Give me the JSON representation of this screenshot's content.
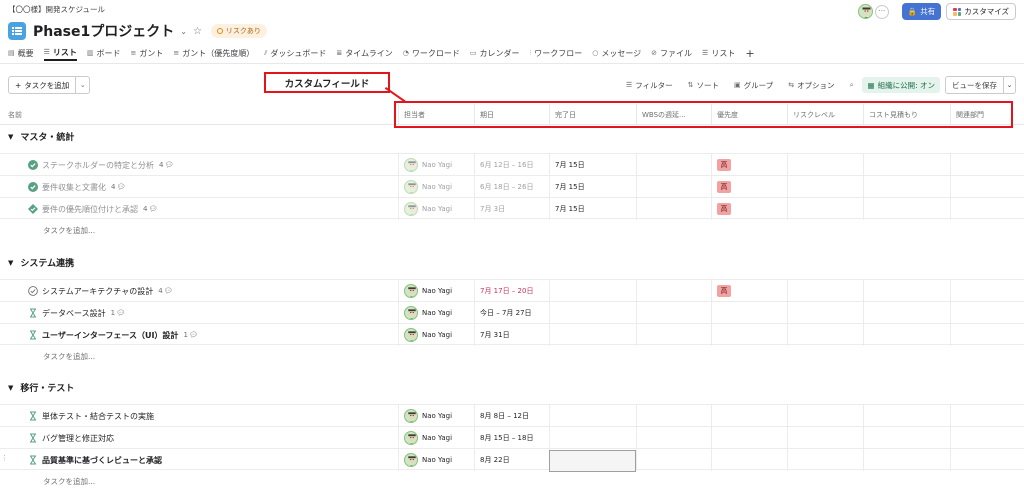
{
  "breadcrumb": "【〇〇様】開発スケジュール",
  "project": {
    "title": "Phase1プロジェクト",
    "risk_label": "リスクあり"
  },
  "top_right": {
    "share_label": "共有",
    "customize_label": "カスタマイズ"
  },
  "tabs": [
    {
      "label": "概要",
      "icon": "overview-icon"
    },
    {
      "label": "リスト",
      "icon": "list-icon",
      "active": true
    },
    {
      "label": "ボード",
      "icon": "board-icon"
    },
    {
      "label": "ガント",
      "icon": "gantt-icon"
    },
    {
      "label": "ガント（優先度順）",
      "icon": "gantt-icon"
    },
    {
      "label": "ダッシュボード",
      "icon": "dashboard-icon"
    },
    {
      "label": "タイムライン",
      "icon": "timeline-icon"
    },
    {
      "label": "ワークロード",
      "icon": "workload-icon"
    },
    {
      "label": "カレンダー",
      "icon": "calendar-icon"
    },
    {
      "label": "ワークフロー",
      "icon": "workflow-icon"
    },
    {
      "label": "メッセージ",
      "icon": "message-icon"
    },
    {
      "label": "ファイル",
      "icon": "file-icon"
    },
    {
      "label": "リスト",
      "icon": "list-icon"
    }
  ],
  "toolbar": {
    "add_task": "タスクを追加",
    "filter": "フィルター",
    "sort": "ソート",
    "group": "グループ",
    "options": "オプション",
    "org_public": "組織に公開: オン",
    "save_view": "ビューを保存"
  },
  "callout": "カスタムフィールド",
  "columns": [
    "名前",
    "担当者",
    "期日",
    "完了日",
    "WBSの週延...",
    "優先度",
    "リスクレベル",
    "コスト見積もり",
    "関連部門"
  ],
  "add_task_row": "タスクを追加...",
  "sections": [
    {
      "title": "マスタ・統計",
      "tasks": [
        {
          "name": "ステークホルダーの特定と分析",
          "subtasks": "4",
          "assignee": "Nao Yagi",
          "due": "6月 12日 – 16日",
          "done_date": "7月 15日",
          "priority": "高",
          "status": "done",
          "icon": "check-circle-icon"
        },
        {
          "name": "要件収集と文書化",
          "subtasks": "4",
          "assignee": "Nao Yagi",
          "due": "6月 18日 – 26日",
          "done_date": "7月 15日",
          "priority": "高",
          "status": "done",
          "icon": "check-circle-icon"
        },
        {
          "name": "要件の優先順位付けと承認",
          "subtasks": "4",
          "assignee": "Nao Yagi",
          "due": "7月 3日",
          "done_date": "7月 15日",
          "priority": "高",
          "status": "done",
          "icon": "milestone-diamond-icon"
        }
      ]
    },
    {
      "title": "システム連携",
      "tasks": [
        {
          "name": "システムアーキテクチャの設計",
          "subtasks": "4",
          "assignee": "Nao Yagi",
          "due": "7月 17日 – 20日",
          "done_date": "",
          "priority": "高",
          "status": "overdue",
          "icon": "check-circle-outline-icon"
        },
        {
          "name": "データベース設計",
          "subtasks": "1",
          "assignee": "Nao Yagi",
          "due": "今日 – 7月 27日",
          "done_date": "",
          "priority": "",
          "status": "open",
          "icon": "hourglass-icon"
        },
        {
          "name": "ユーザーインターフェース（UI）設計",
          "subtasks": "1",
          "assignee": "Nao Yagi",
          "due": "7月 31日",
          "done_date": "",
          "priority": "",
          "status": "bold",
          "icon": "hourglass-icon"
        }
      ]
    },
    {
      "title": "移行・テスト",
      "tasks": [
        {
          "name": "単体テスト・結合テストの実施",
          "subtasks": "",
          "assignee": "Nao Yagi",
          "due": "8月 8日 – 12日",
          "done_date": "",
          "priority": "",
          "status": "open",
          "icon": "hourglass-icon"
        },
        {
          "name": "バグ管理と修正対応",
          "subtasks": "",
          "assignee": "Nao Yagi",
          "due": "8月 15日 – 18日",
          "done_date": "",
          "priority": "",
          "status": "open",
          "icon": "hourglass-icon"
        },
        {
          "name": "品質基準に基づくレビューと承認",
          "subtasks": "",
          "assignee": "Nao Yagi",
          "due": "8月 22日",
          "done_date": "",
          "priority": "",
          "status": "bold",
          "icon": "hourglass-icon"
        }
      ]
    }
  ],
  "colors": {
    "accent": "#4573d2",
    "risk": "#e08a16",
    "priority_high": "#f2a2a2",
    "done_check": "#58a182",
    "overdue": "#c92f54",
    "callout_border": "#e3141b"
  }
}
